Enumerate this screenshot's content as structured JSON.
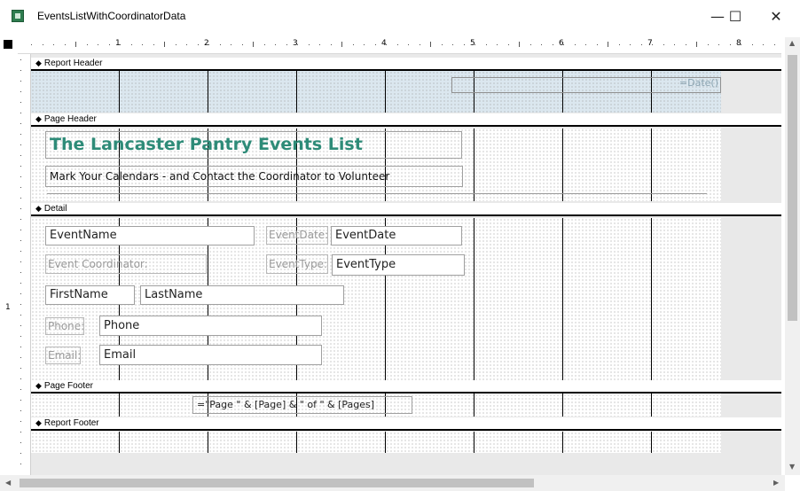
{
  "window": {
    "title": "EventsListWithCoordinatorData",
    "minimize": "—",
    "maximize": "☐",
    "close": "✕"
  },
  "ruler": {
    "marks": [
      "1",
      "2",
      "3",
      "4",
      "5",
      "6",
      "7",
      "8"
    ]
  },
  "sections": {
    "report_header": "Report Header",
    "page_header": "Page Header",
    "detail": "Detail",
    "page_footer": "Page Footer",
    "report_footer": "Report Footer"
  },
  "report_header": {
    "date_control": "=Date()"
  },
  "page_header": {
    "title": "The Lancaster Pantry Events List",
    "subtitle": "Mark Your Calendars - and Contact the Coordinator to Volunteer"
  },
  "detail": {
    "event_name": "EventName",
    "event_date_label": "EventDate:",
    "event_date": "EventDate",
    "event_coordinator_label": "Event Coordinator:",
    "event_type_label": "EventType:",
    "event_type": "EventType",
    "first_name": "FirstName",
    "last_name": "LastName",
    "phone_label": "Phone:",
    "phone": "Phone",
    "email_label": "Email:",
    "email": "Email"
  },
  "page_footer": {
    "page_expression": "=\"Page \" & [Page] & \" of \" & [Pages]"
  },
  "colors": {
    "title_accent": "#2e8b78",
    "report_header_band": "#dbe7ef"
  },
  "icons": {
    "app": "access-report-icon",
    "section_arrow": "section-arrow-icon"
  }
}
